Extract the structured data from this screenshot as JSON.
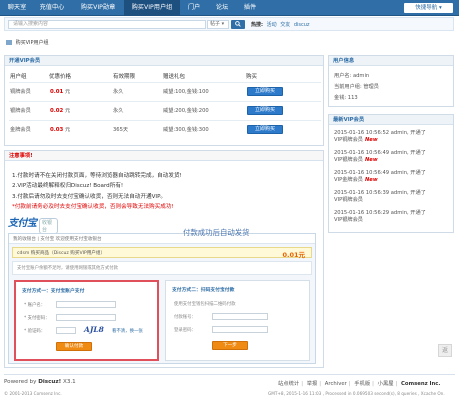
{
  "topnav": {
    "items": [
      "聊天室",
      "充值中心",
      "购买VIP勋章",
      "购买VIP用户组",
      "门户",
      "论坛",
      "插件"
    ],
    "quick_nav": "快捷导航"
  },
  "search": {
    "placeholder": "请输入搜索内容",
    "type_label": "帖子",
    "hot_label": "热搜:",
    "hot_words": [
      "活动",
      "交友",
      "discuz"
    ]
  },
  "breadcrumb": {
    "current": "购买VIP用户组"
  },
  "vip_box": {
    "title": "开通VIP会员",
    "headers": [
      "用户组",
      "优惠价格",
      "有效期限",
      "赠送礼包",
      "购买"
    ],
    "rows": [
      {
        "group": "铜牌会员",
        "price": "0.01",
        "unit": "元",
        "term": "永久",
        "gift": "威望:100,金钱:100",
        "buy": "立即购买"
      },
      {
        "group": "银牌会员",
        "price": "0.02",
        "unit": "元",
        "term": "永久",
        "gift": "威望:200,金钱:200",
        "buy": "立即购买"
      },
      {
        "group": "金牌会员",
        "price": "0.03",
        "unit": "元",
        "term": "365天",
        "gift": "威望:300,金钱:300",
        "buy": "立即购买"
      }
    ]
  },
  "notice": {
    "title": "注意事项!",
    "lines": [
      "1.付款时请不在关闭付款页面，等待浏览器自动跳转完成，自动发货!",
      "2.VIP活动最终解释权归Discuz! Board所有!",
      "3.付款后请勿及时去支付宝确认收货，否则无法自动开通VIP。"
    ],
    "warning": "*付款前请务必及时去支付宝确认收货，否则会导致无法购买成功!",
    "alipay_logo": "支付宝",
    "alipay_sub": "收银台",
    "screenshot": {
      "top_text": "我的收银台  |  支付宝  欢迎使用支付宝收银台",
      "order_text": "cdsm  购买商品（Discuz 购买VIP用户组）",
      "amount": "0.01元",
      "overlay": "付款成功后自动发货",
      "info_text": "支付宝账户余额不足时，请使用网银或其他方式付款",
      "left_title": "支付方式一：支付宝账户支付",
      "left_fields": [
        "* 账户名：",
        "* 支付密码：",
        "* 验证码："
      ],
      "captcha": "AJL8",
      "captcha_link": "看不清，换一张",
      "left_button": "确认付款",
      "right_title": "支付方式二：扫码支付宝付款",
      "right_lines": [
        "使用支付宝钱包扫描二维码付款",
        "付款账号：",
        "登录密码："
      ],
      "right_button": "下一步"
    }
  },
  "userinfo": {
    "title": "用户信息",
    "rows": [
      "用户名: admin",
      "当前用户组: 管理员",
      "金钱: 113"
    ]
  },
  "recent": {
    "title": "最新VIP会员",
    "entries": [
      {
        "line1": "2015-01-16 10:56:52 admin, 开通了",
        "line2": "VIP铜牌会员",
        "new": "New"
      },
      {
        "line1": "2015-01-16 10:56:49 admin, 开通了",
        "line2": "VIP银牌会员",
        "new": "New"
      },
      {
        "line1": "2015-01-16 10:56:49 admin, 开通了",
        "line2": "VIP金牌会员",
        "new": "New"
      },
      {
        "line1": "2015-01-16 10:56:39 admin, 开通了",
        "line2": "VIP铜牌会员",
        "new": ""
      },
      {
        "line1": "2015-01-16 10:56:29 admin, 开通了",
        "line2": "VIP银牌会员",
        "new": ""
      }
    ]
  },
  "scroll_top": "返",
  "footer": {
    "powered_prefix": "Powered by ",
    "powered_brand": "Discuz!",
    "powered_version": " X3.1",
    "copyright": "© 2001-2013 Comsenz Inc.",
    "links": [
      "站点统计",
      "举报",
      "Archiver",
      "手机版",
      "小黑屋"
    ],
    "company": "Comsenz Inc.",
    "gmt": "GMT+8, 2015-1-16 11:03 , Processed in 0.069503 second(s), 8 queries , Xcache On."
  }
}
